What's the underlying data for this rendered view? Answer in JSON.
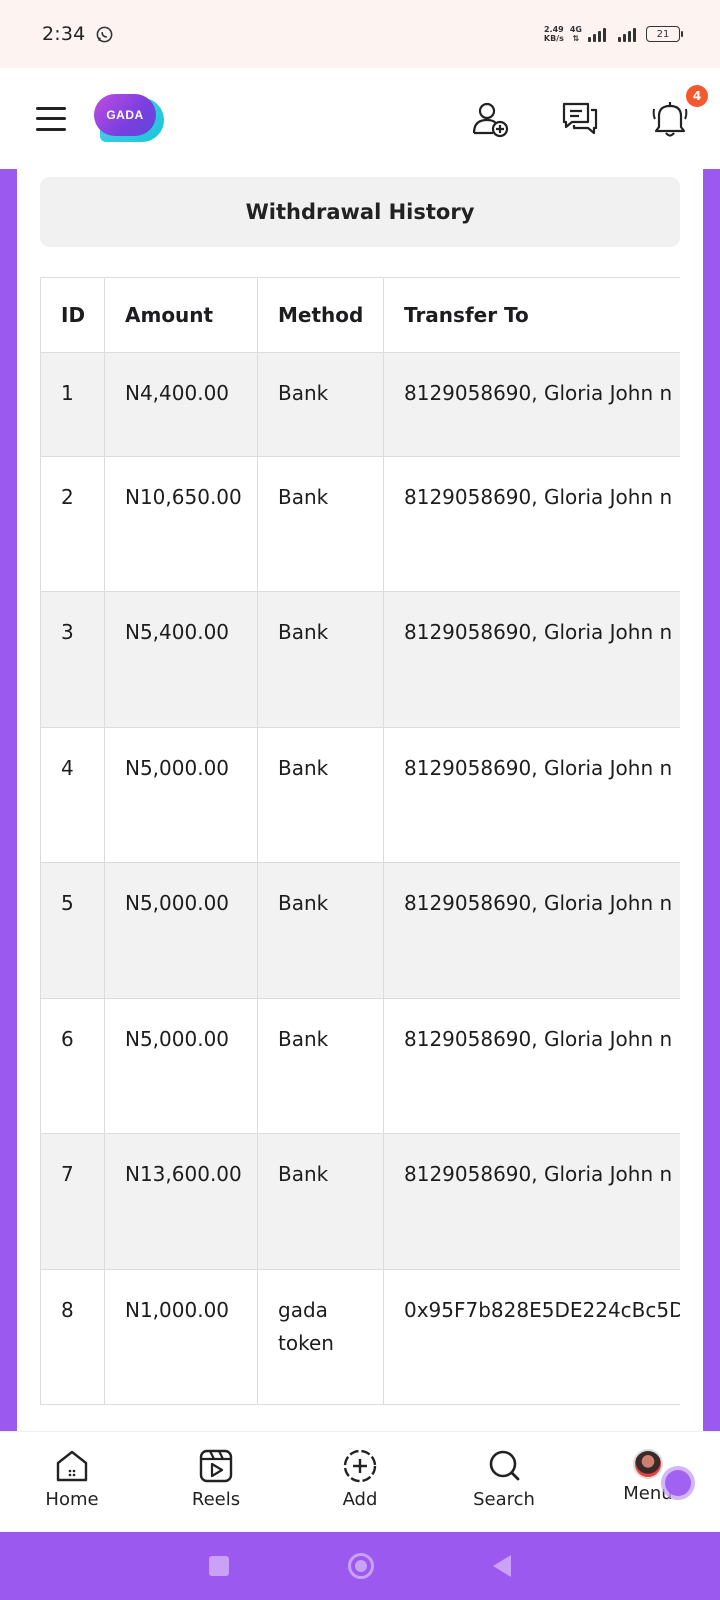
{
  "status_bar": {
    "time": "2:34",
    "net_speed_value": "2.49",
    "net_speed_unit": "KB/s",
    "network_type": "4G",
    "battery": "21"
  },
  "app_bar": {
    "logo_text": "GADA",
    "notification_count": "4",
    "icons": [
      "menu-icon",
      "add-friend-icon",
      "messages-icon",
      "bell-icon"
    ]
  },
  "page": {
    "title": "Withdrawal History"
  },
  "table": {
    "headers": [
      "ID",
      "Amount",
      "Method",
      "Transfer To"
    ],
    "rows": [
      {
        "id": "1",
        "amount": "N4,400.00",
        "method": "Bank",
        "transfer_to": "8129058690, Gloria John n"
      },
      {
        "id": "2",
        "amount": "N10,650.00",
        "method": "Bank",
        "transfer_to": "8129058690, Gloria John n"
      },
      {
        "id": "3",
        "amount": "N5,400.00",
        "method": "Bank",
        "transfer_to": "8129058690, Gloria John n"
      },
      {
        "id": "4",
        "amount": "N5,000.00",
        "method": "Bank",
        "transfer_to": "8129058690, Gloria John n"
      },
      {
        "id": "5",
        "amount": "N5,000.00",
        "method": "Bank",
        "transfer_to": "8129058690, Gloria John n"
      },
      {
        "id": "6",
        "amount": "N5,000.00",
        "method": "Bank",
        "transfer_to": "8129058690, Gloria John n"
      },
      {
        "id": "7",
        "amount": "N13,600.00",
        "method": "Bank",
        "transfer_to": "8129058690, Gloria John n"
      },
      {
        "id": "8",
        "amount": "N1,000.00",
        "method": "gada token",
        "transfer_to": "0x95F7b828E5DE224cBc5D"
      }
    ]
  },
  "bottom_nav": {
    "items": [
      {
        "label": "Home",
        "icon": "home-icon"
      },
      {
        "label": "Reels",
        "icon": "reels-icon"
      },
      {
        "label": "Add",
        "icon": "add-icon"
      },
      {
        "label": "Search",
        "icon": "search-icon"
      },
      {
        "label": "Menu",
        "icon": "avatar"
      }
    ]
  },
  "colors": {
    "accent": "#9b59f0",
    "badge": "#f4582c",
    "row_shade": "#f2f2f2"
  }
}
